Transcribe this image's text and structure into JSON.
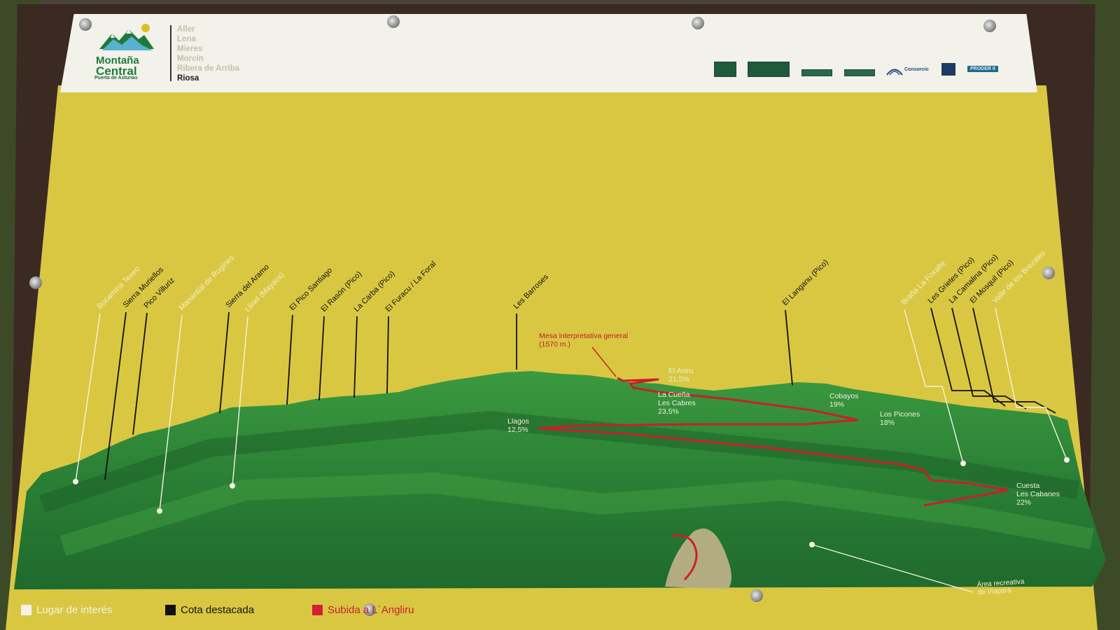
{
  "header": {
    "brand_line1": "Montaña",
    "brand_line2": "Central",
    "brand_tagline": "Puerta de Asturias",
    "municipalities": [
      "Aller",
      "Lena",
      "Mieres",
      "Morcín",
      "Ribera de Arriba",
      "Riosa"
    ],
    "active_municipality": "Riosa",
    "sponsor_consorcio": "Consorcio",
    "sponsor_proder": "PRODER II"
  },
  "labels": {
    "peaks": [
      {
        "text": "Bocamina Texeo",
        "kind": "interest"
      },
      {
        "text": "Sierra Muriellos",
        "kind": "peak"
      },
      {
        "text": "Pico Villuriz",
        "kind": "peak"
      },
      {
        "text": "Manantial de Rogines",
        "kind": "interest"
      },
      {
        "text": "Sierra del Aramo",
        "kind": "peak"
      },
      {
        "text": "Llinel (Mayaos)",
        "kind": "interest"
      },
      {
        "text": "El Pico Santiago",
        "kind": "peak"
      },
      {
        "text": "El Rasón (Pico)",
        "kind": "peak"
      },
      {
        "text": "La Carba (Pico)",
        "kind": "peak"
      },
      {
        "text": "El Furacu / La Foral",
        "kind": "peak"
      },
      {
        "text": "Les Barroses",
        "kind": "peak"
      },
      {
        "text": "El Langanu (Pico)",
        "kind": "peak"
      },
      {
        "text": "Braña La Foxalte",
        "kind": "interest"
      },
      {
        "text": "Les Grietes (Pico)",
        "kind": "peak"
      },
      {
        "text": "La Camalina (Pico)",
        "kind": "peak"
      },
      {
        "text": "El Mosquil (Pico)",
        "kind": "peak"
      },
      {
        "text": "Valle de los Brezales",
        "kind": "interest"
      }
    ],
    "mesa": [
      "Mesa interpretativa general",
      "(1570 m.)"
    ],
    "route_points": [
      [
        "El Aviru",
        "21,5%"
      ],
      [
        "La Cueña",
        "Les Cabres",
        "23,5%"
      ],
      [
        "Cobayos",
        "19%"
      ],
      [
        "Llagos",
        "12,5%"
      ],
      [
        "Los Picones",
        "18%"
      ],
      [
        "Cuesta",
        "Les Cabanes",
        "22%"
      ]
    ],
    "area": [
      "Área recreativa",
      "de Viapará"
    ]
  },
  "legend": [
    {
      "label": "Lugar de interés",
      "color": "#f4f2e8"
    },
    {
      "label": "Cota destacada",
      "color": "#111111"
    },
    {
      "label": "Subida a L´Angliru",
      "color": "#d42030"
    }
  ],
  "colors": {
    "panel": "#d9c742",
    "header": "#f2f1ea",
    "mountain": "#2f8a3a",
    "route": "#c8202a"
  }
}
